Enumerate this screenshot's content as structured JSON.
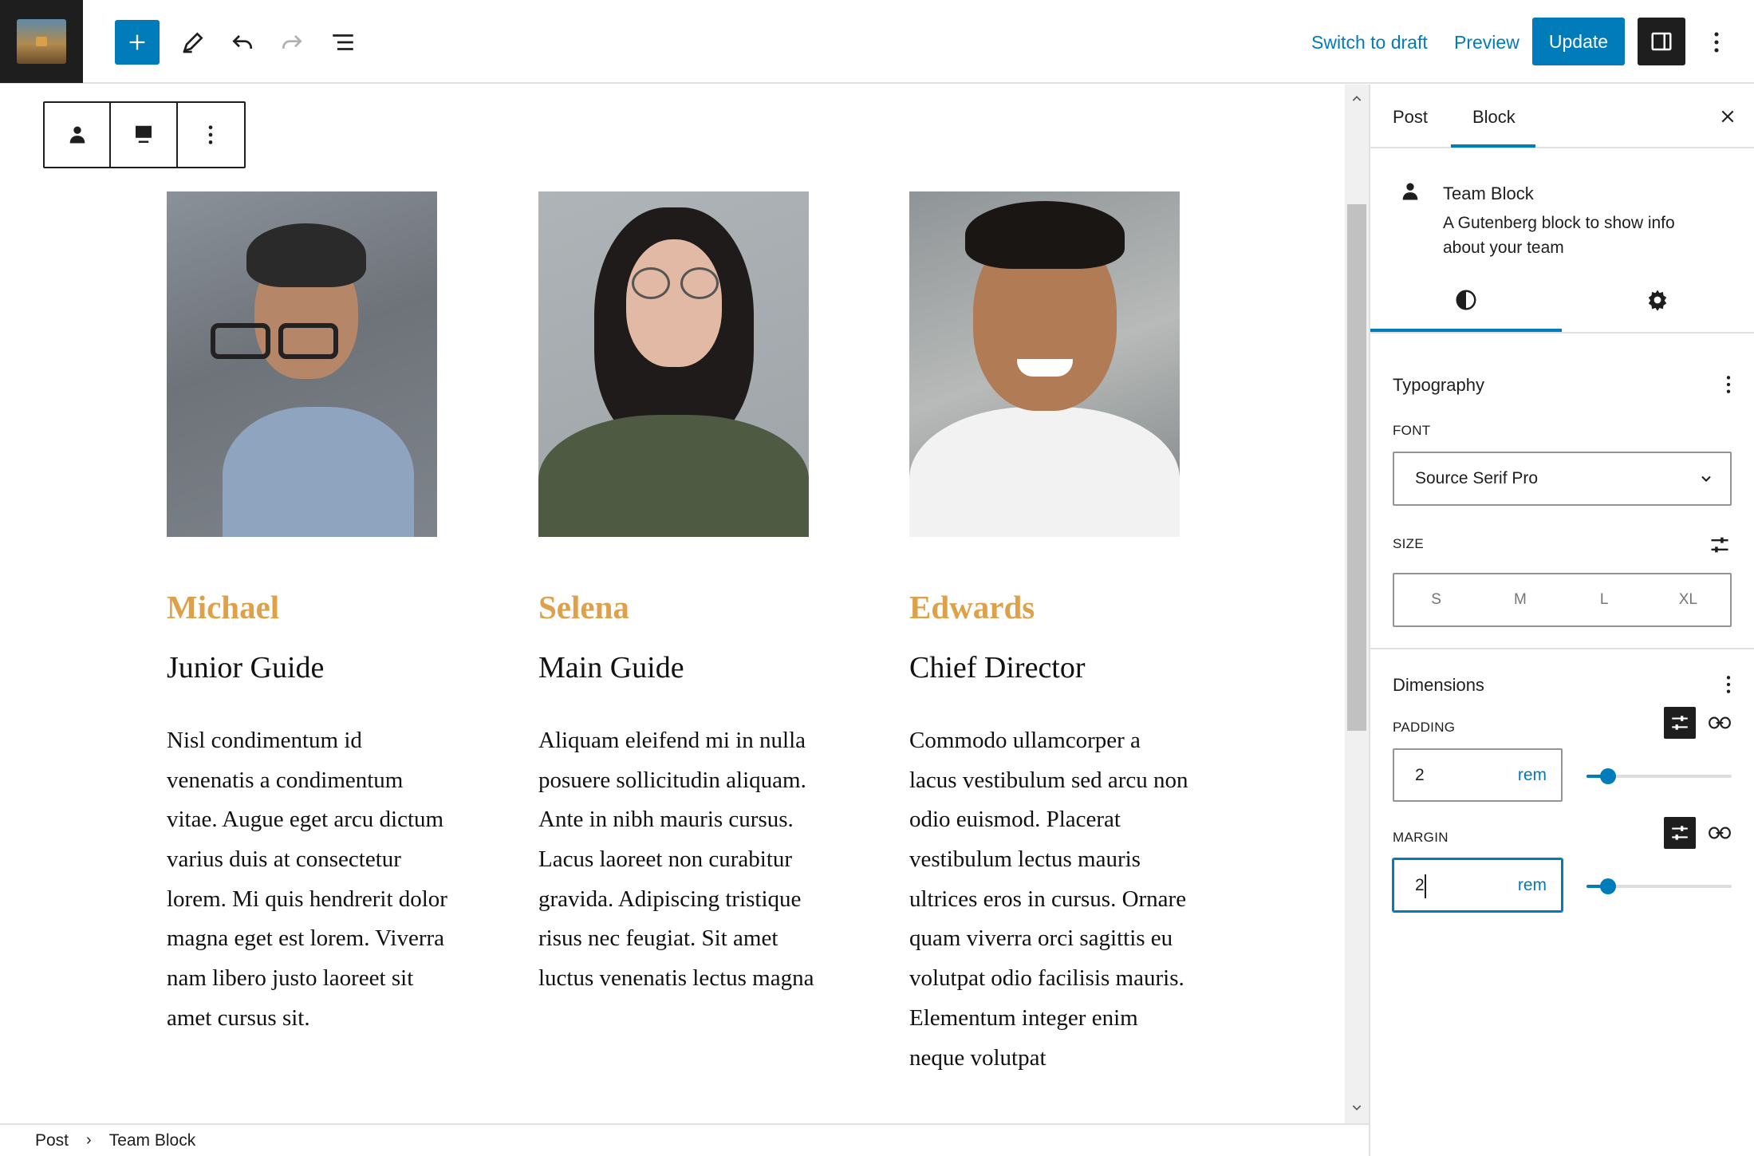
{
  "topbar": {
    "site_icon": "site-thumbnail",
    "add_icon": "plus-icon",
    "edit_icon": "pencil-icon",
    "undo_icon": "undo-icon",
    "redo_icon": "redo-icon",
    "list_icon": "list-view-icon",
    "switch_to_draft": "Switch to draft",
    "preview": "Preview",
    "update": "Update",
    "settings_icon": "sidebar-toggle-icon",
    "more_icon": "more-vertical-icon"
  },
  "block_toolbar": {
    "items": [
      "person-icon",
      "align-icon",
      "more-vertical-icon"
    ]
  },
  "team": [
    {
      "name": "Michael",
      "role": "Junior Guide",
      "bio": "Nisl condimentum id venenatis a condimentum vitae. Augue eget arcu dictum varius duis at consectetur lorem. Mi quis hendrerit dolor magna eget est lorem. Viverra nam libero justo laoreet sit amet cursus sit."
    },
    {
      "name": "Selena",
      "role": "Main Guide",
      "bio": "Aliquam eleifend mi in nulla posuere sollicitudin aliquam. Ante in nibh mauris cursus. Lacus laoreet non curabitur gravida. Adipiscing tristique risus nec feugiat. Sit amet luctus venenatis lectus magna"
    },
    {
      "name": "Edwards",
      "role": "Chief Director",
      "bio": "Commodo ullamcorper a lacus vestibulum sed arcu non odio euismod. Placerat vestibulum lectus mauris ultrices eros in cursus. Ornare quam viverra orci sagittis eu volutpat odio facilisis mauris. Elementum integer enim neque volutpat"
    }
  ],
  "breadcrumb": {
    "items": [
      "Post",
      "Team Block"
    ]
  },
  "sidebar": {
    "tabs": [
      "Post",
      "Block"
    ],
    "active_tab": "Block",
    "block": {
      "title": "Team Block",
      "description": "A Gutenberg block to show info about your team"
    },
    "subtabs": [
      "styles-icon",
      "settings-gear-icon"
    ],
    "typography": {
      "title": "Typography",
      "font_label": "FONT",
      "font_value": "Source Serif Pro",
      "size_label": "SIZE",
      "size_options": [
        "S",
        "M",
        "L",
        "XL"
      ]
    },
    "dimensions": {
      "title": "Dimensions",
      "padding_label": "PADDING",
      "padding_value": "2",
      "padding_unit": "rem",
      "padding_slider": 0.15,
      "margin_label": "MARGIN",
      "margin_value": "2",
      "margin_unit": "rem",
      "margin_slider": 0.15
    }
  },
  "colors": {
    "accent": "#007cba",
    "name_color": "#dea14a",
    "dark": "#1e1e1e"
  }
}
